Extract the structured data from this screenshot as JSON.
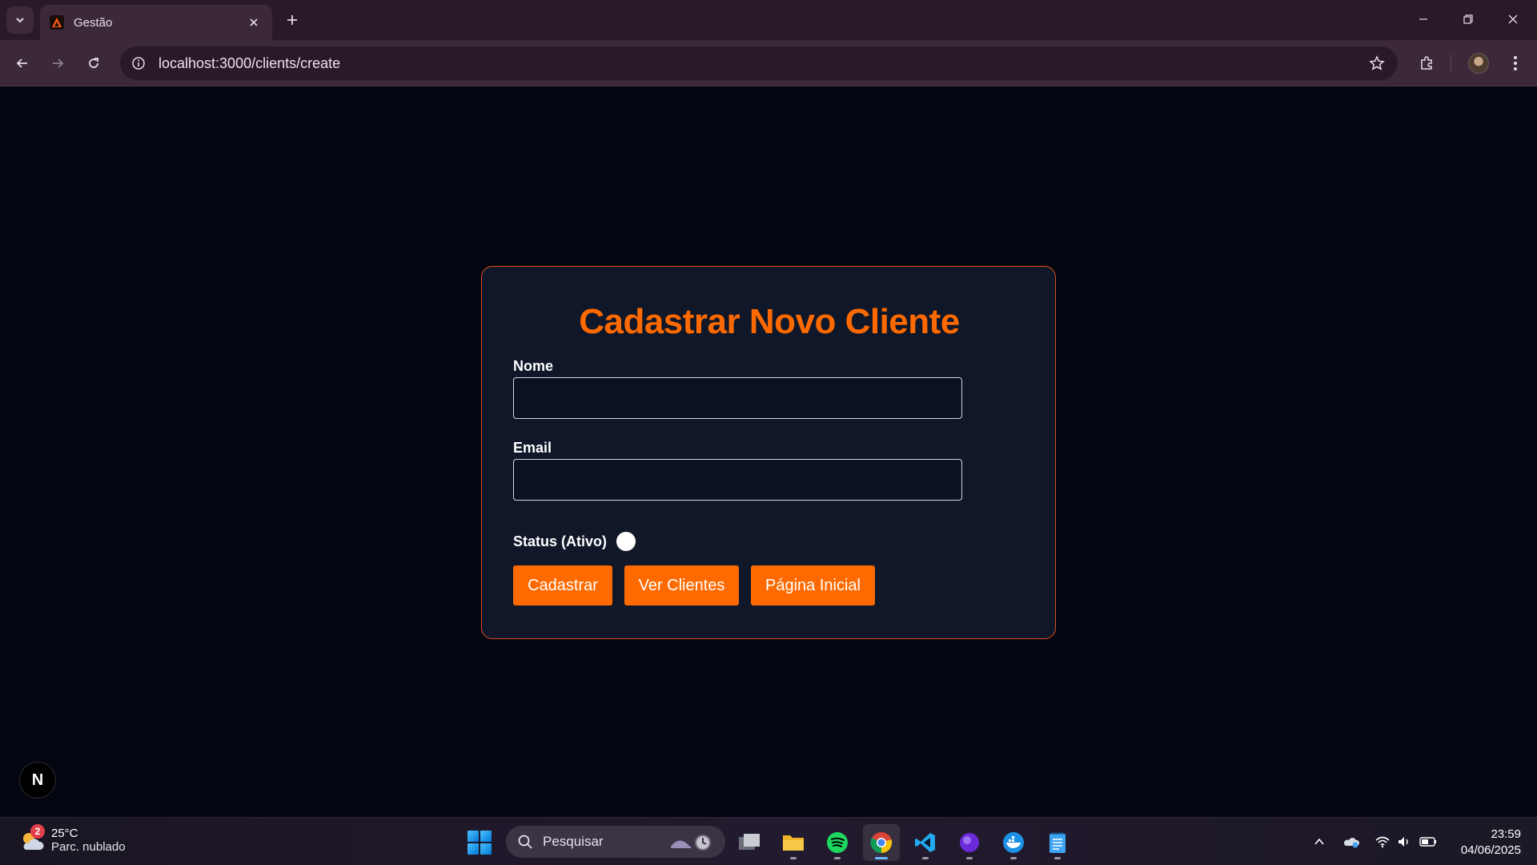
{
  "browser": {
    "tab_title": "Gestão",
    "url": "localhost:3000/clients/create"
  },
  "form": {
    "title": "Cadastrar Novo Cliente",
    "name_label": "Nome",
    "name_value": "",
    "email_label": "Email",
    "email_value": "",
    "status_label": "Status (Ativo)",
    "status_on": false,
    "buttons": {
      "submit": "Cadastrar",
      "view_clients": "Ver Clientes",
      "home": "Página Inicial"
    }
  },
  "next_badge": "N",
  "taskbar": {
    "weather_badge": "2",
    "weather_temp": "25°C",
    "weather_cond": "Parc. nublado",
    "search_placeholder": "Pesquisar",
    "time": "23:59",
    "date": "04/06/2025"
  },
  "colors": {
    "accent": "#ff6a00",
    "card_bg": "#0f1729",
    "page_bg": "#030510",
    "card_border": "#e0501a"
  },
  "icons": [
    "tab-list-icon",
    "favicon-icon",
    "close-icon",
    "plus-icon",
    "minimize-icon",
    "restore-icon",
    "window-close-icon",
    "back-icon",
    "forward-icon",
    "reload-icon",
    "info-icon",
    "star-icon",
    "extensions-icon",
    "avatar",
    "menu-icon",
    "windows-start-icon",
    "search-icon",
    "file-manager-icon",
    "folder-icon",
    "spotify-icon",
    "chrome-icon",
    "vscode-icon",
    "purple-app-icon",
    "docker-icon",
    "notepad-icon",
    "chevron-up-icon",
    "onedrive-icon",
    "wifi-icon",
    "volume-icon",
    "battery-icon"
  ]
}
